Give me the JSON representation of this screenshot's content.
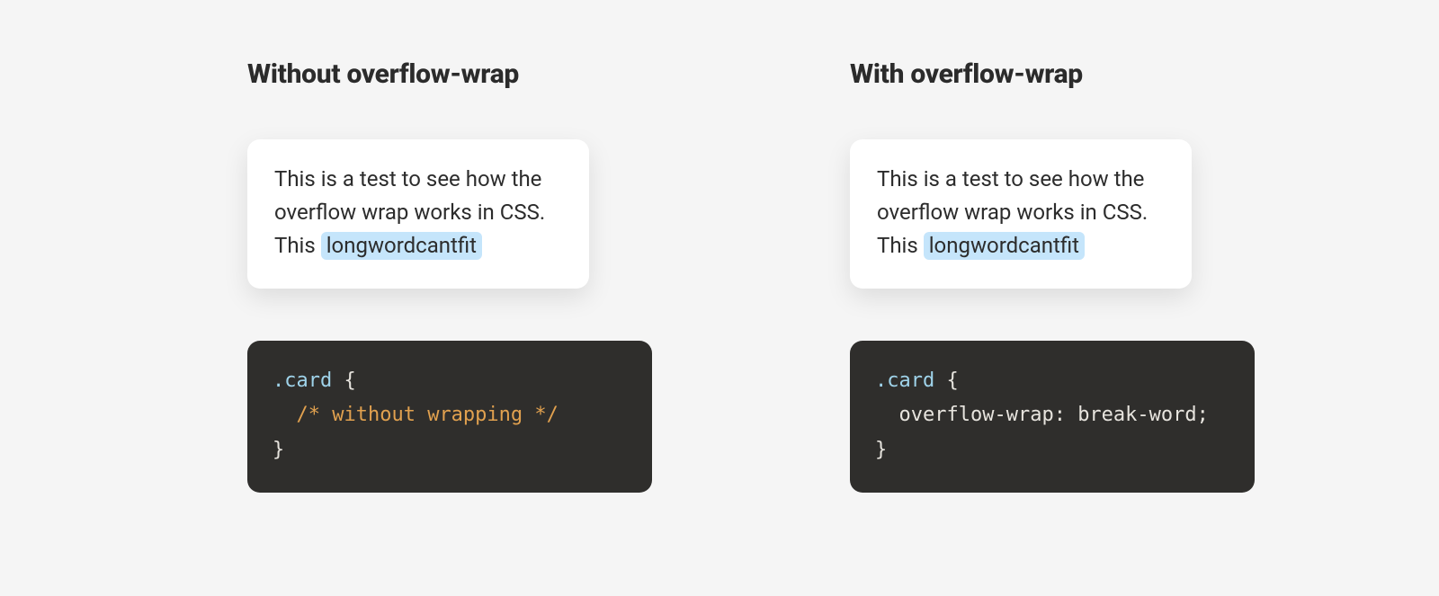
{
  "left": {
    "heading": "Without overflow-wrap",
    "card": {
      "prefix": "This is a test to see how the overflow wrap works in CSS. This ",
      "highlighted_word": "longwordcantfit"
    },
    "code": {
      "selector": ".card",
      "open_brace": " {",
      "indent": "  ",
      "comment": "/* without wrapping */",
      "close_brace": "}"
    }
  },
  "right": {
    "heading": "With overflow-wrap",
    "card": {
      "prefix": "This is a test to see how the overflow wrap works in CSS. This ",
      "highlighted_word": "longwordcantfit"
    },
    "code": {
      "selector": ".card",
      "open_brace": " {",
      "indent": "  ",
      "property": "overflow-wrap",
      "colon_space": ": ",
      "value": "break-word",
      "semicolon": ";",
      "close_brace": "}"
    }
  },
  "colors": {
    "page_bg": "#f5f5f5",
    "card_bg": "#ffffff",
    "code_bg": "#2f2e2c",
    "highlight_bg": "#c5e5fb",
    "text": "#2c2c2c",
    "code_text": "#e7e4de",
    "code_selector": "#9fd3ea",
    "code_comment": "#e1a14f"
  }
}
